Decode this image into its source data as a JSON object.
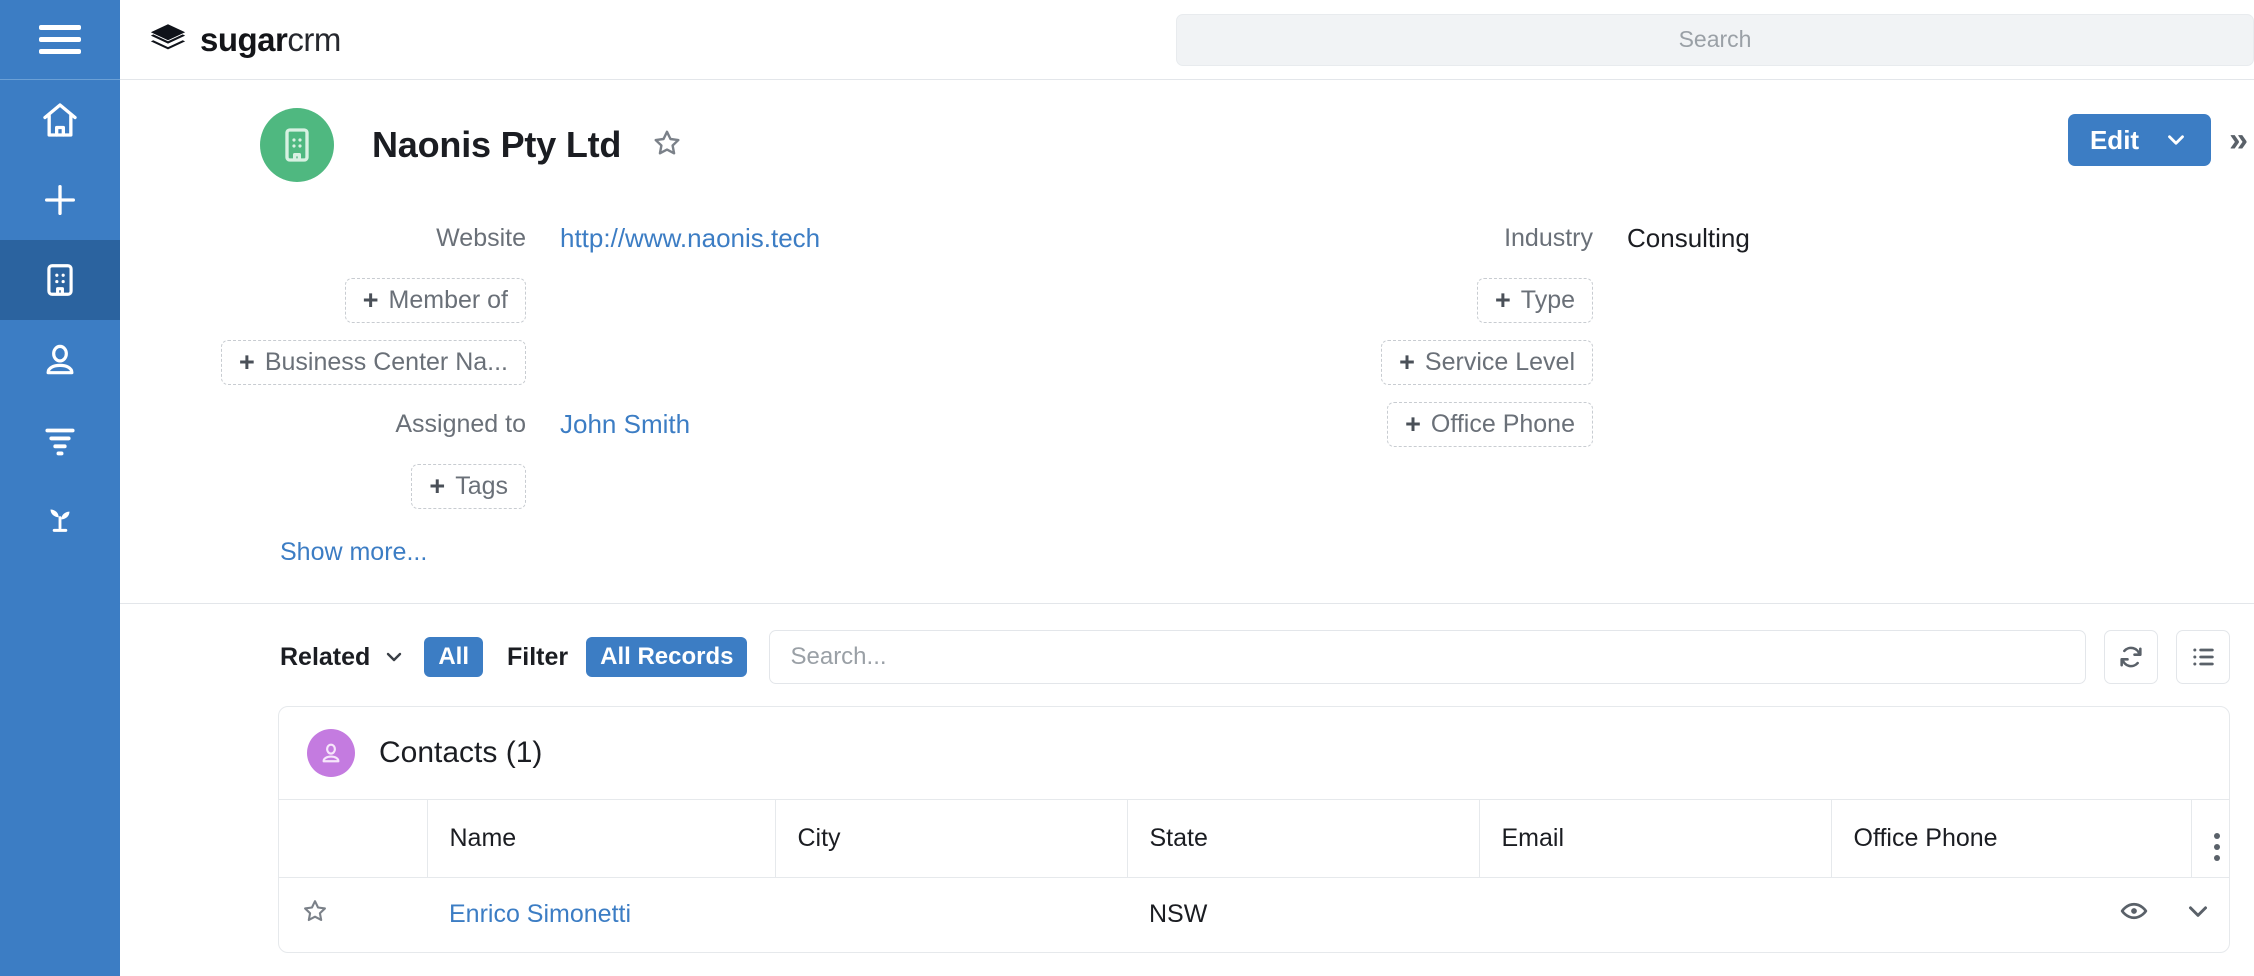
{
  "sidebar": {
    "items": [
      {
        "name": "menu-toggle",
        "icon": "hamburger-icon",
        "active": false
      },
      {
        "name": "home",
        "icon": "home-icon",
        "active": false
      },
      {
        "name": "create",
        "icon": "plus-icon",
        "active": false
      },
      {
        "name": "accounts",
        "icon": "building-icon",
        "active": true
      },
      {
        "name": "contacts",
        "icon": "person-icon",
        "active": false
      },
      {
        "name": "leads",
        "icon": "funnel-icon",
        "active": false
      },
      {
        "name": "opportunities",
        "icon": "sprout-icon",
        "active": false
      }
    ]
  },
  "header": {
    "brand_bold": "sugar",
    "brand_light": "crm",
    "logo_icon": "sugarcrm-stack-logo",
    "search_placeholder": "Search",
    "search_value": ""
  },
  "record": {
    "avatar_icon": "building-icon",
    "title": "Naonis Pty Ltd",
    "favorite_icon": "star-outline-icon",
    "edit_label": "Edit",
    "edit_chevron_icon": "chevron-down-icon",
    "more_icon": "double-chevron-right-icon",
    "show_more_label": "Show more...",
    "fields_left": [
      {
        "label": "Website",
        "value": "http://www.naonis.tech",
        "type": "link"
      },
      {
        "label": "+ Member of",
        "type": "placeholder"
      },
      {
        "label": "+ Business Center Na...",
        "type": "placeholder"
      },
      {
        "label": "Assigned to",
        "value": "John Smith",
        "type": "link"
      },
      {
        "label": "+ Tags",
        "type": "placeholder"
      }
    ],
    "fields_right": [
      {
        "label": "Industry",
        "value": "Consulting",
        "type": "text"
      },
      {
        "label": "+ Type",
        "type": "placeholder"
      },
      {
        "label": "+ Service Level",
        "type": "placeholder"
      },
      {
        "label": "+ Office Phone",
        "type": "placeholder"
      }
    ]
  },
  "related": {
    "related_label": "Related",
    "related_chevron_icon": "chevron-down-icon",
    "all_pill": "All",
    "filter_label": "Filter",
    "filter_pill": "All Records",
    "search_placeholder": "Search...",
    "search_value": "",
    "refresh_icon": "refresh-icon",
    "list_view_icon": "list-icon"
  },
  "panel": {
    "avatar_icon": "person-icon",
    "title": "Contacts (1)",
    "columns": [
      "",
      "Name",
      "City",
      "State",
      "Email",
      "Office Phone"
    ],
    "kebab_icon": "kebab-menu-icon",
    "rows": [
      {
        "star_icon": "star-outline-icon",
        "name": "Enrico Simonetti",
        "city": "",
        "state": "NSW",
        "email": "",
        "office_phone": "",
        "preview_icon": "eye-icon",
        "expand_icon": "chevron-down-icon"
      }
    ]
  },
  "colors": {
    "sidebar": "#3c7dc4",
    "sidebar_active": "#2b639f",
    "accent": "#3c7dc4",
    "record_avatar": "#4fb880",
    "panel_avatar": "#c47be0",
    "link": "#3c7dc4"
  }
}
